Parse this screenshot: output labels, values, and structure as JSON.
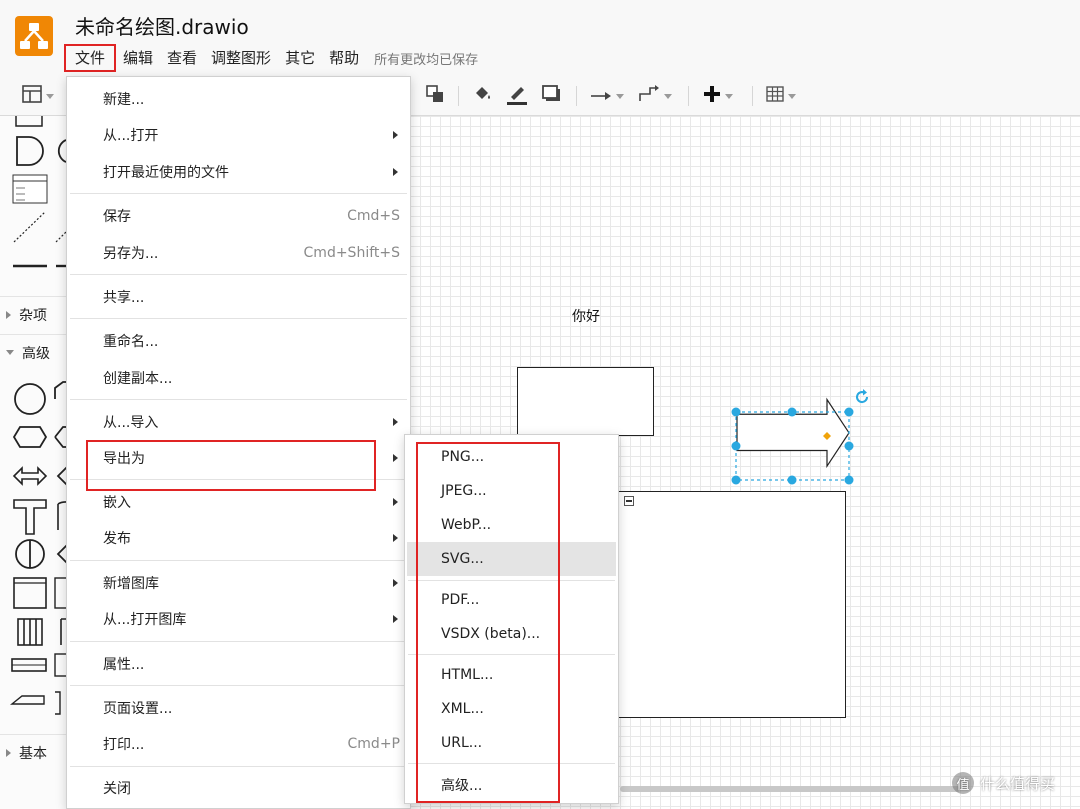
{
  "app": {
    "title": "未命名绘图.drawio",
    "saved_status": "所有更改均已保存"
  },
  "menubar": [
    {
      "label": "文件"
    },
    {
      "label": "编辑"
    },
    {
      "label": "查看"
    },
    {
      "label": "调整图形"
    },
    {
      "label": "其它"
    },
    {
      "label": "帮助"
    }
  ],
  "sidebar": {
    "sections": [
      {
        "label": "杂项",
        "state": "collapsed"
      },
      {
        "label": "高级",
        "state": "expanded"
      },
      {
        "label": "基本",
        "state": "collapsed"
      }
    ]
  },
  "canvas": {
    "text_label": "你好"
  },
  "file_menu": {
    "items": [
      {
        "label": "新建...",
        "shortcut": "",
        "submenu": false
      },
      {
        "label": "从...打开",
        "shortcut": "",
        "submenu": true
      },
      {
        "label": "打开最近使用的文件",
        "shortcut": "",
        "submenu": true
      },
      {
        "label": "保存",
        "shortcut": "Cmd+S",
        "submenu": false
      },
      {
        "label": "另存为...",
        "shortcut": "Cmd+Shift+S",
        "submenu": false
      },
      {
        "label": "共享...",
        "shortcut": "",
        "submenu": false
      },
      {
        "label": "重命名...",
        "shortcut": "",
        "submenu": false
      },
      {
        "label": "创建副本...",
        "shortcut": "",
        "submenu": false
      },
      {
        "label": "从...导入",
        "shortcut": "",
        "submenu": true
      },
      {
        "label": "导出为",
        "shortcut": "",
        "submenu": true
      },
      {
        "label": "嵌入",
        "shortcut": "",
        "submenu": true
      },
      {
        "label": "发布",
        "shortcut": "",
        "submenu": true
      },
      {
        "label": "新增图库",
        "shortcut": "",
        "submenu": true
      },
      {
        "label": "从...打开图库",
        "shortcut": "",
        "submenu": true
      },
      {
        "label": "属性...",
        "shortcut": "",
        "submenu": false
      },
      {
        "label": "页面设置...",
        "shortcut": "",
        "submenu": false
      },
      {
        "label": "打印...",
        "shortcut": "Cmd+P",
        "submenu": false
      },
      {
        "label": "关闭",
        "shortcut": "",
        "submenu": false
      }
    ]
  },
  "export_menu": {
    "items": [
      {
        "label": "PNG..."
      },
      {
        "label": "JPEG..."
      },
      {
        "label": "WebP..."
      },
      {
        "label": "SVG...",
        "highlighted": true
      },
      {
        "label": "PDF..."
      },
      {
        "label": "VSDX (beta)..."
      },
      {
        "label": "HTML..."
      },
      {
        "label": "XML..."
      },
      {
        "label": "URL..."
      },
      {
        "label": "高级..."
      }
    ]
  },
  "watermark": {
    "text": "什么值得买",
    "icon_glyph": "值"
  },
  "colors": {
    "accent_orange": "#f08705",
    "annotation_red": "#e02424",
    "selection_blue": "#29a8e0",
    "handle_orange": "#f0a30a"
  },
  "icons": [
    "drawio-logo-icon",
    "format-panel-icon",
    "to-back-icon",
    "fill-color-icon",
    "line-color-icon",
    "shadow-icon",
    "connection-icon",
    "waypoints-icon",
    "insert-plus-icon",
    "table-icon",
    "rotate-icon"
  ]
}
